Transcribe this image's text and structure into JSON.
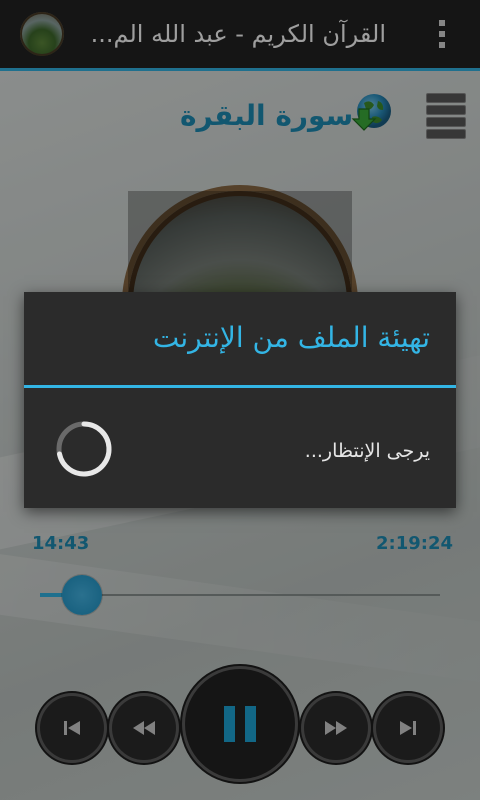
{
  "app_bar": {
    "title": "القرآن الكريم - عبد الله الم...",
    "app_icon": "landscape-thumbnail-icon",
    "overflow_icon": "overflow-menu-icon"
  },
  "player": {
    "surah_title": "سورة البقرة",
    "download_icon": "globe-download-icon",
    "playlist_icon": "playlist-icon",
    "elapsed_time": "14:43",
    "total_time": "2:19:24",
    "progress_fraction": 0.105,
    "controls": [
      "skip-previous-icon",
      "rewind-icon",
      "pause-icon",
      "fast-forward-icon",
      "skip-next-icon"
    ]
  },
  "dialog": {
    "title": "تهيئة الملف من الإنترنت",
    "message": "يرجى الإنتظار..."
  },
  "colors": {
    "accent": "#33b5e5",
    "title_blue": "#1d8db5",
    "action_bar": "#232323",
    "dialog_bg": "#2b2b2b"
  }
}
